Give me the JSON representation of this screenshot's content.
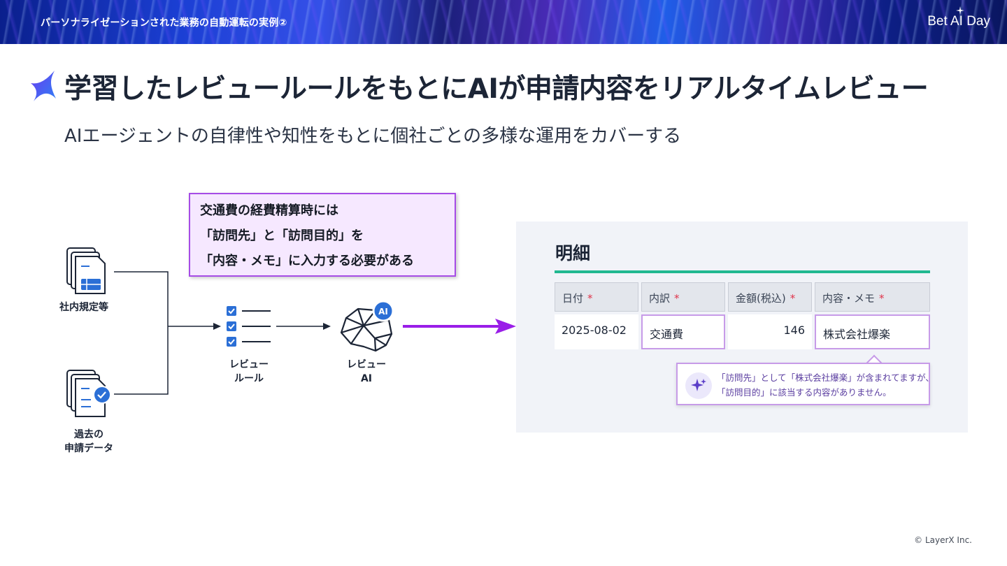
{
  "header": {
    "banner_title": "パーソナライゼーションされた業務の自動運転の実例②",
    "brand": "Bet AI Day"
  },
  "slide": {
    "title": "学習したレビュールールをもとにAIが申請内容をリアルタイムレビュー",
    "subtitle": "AIエージェントの自律性や知性をもとに個社ごとの多様な運用をカバーする"
  },
  "note": {
    "lines": [
      "交通費の経費精算時には",
      "「訪問先」と「訪問目的」を",
      "「内容・メモ」に入力する必要がある"
    ]
  },
  "diagram": {
    "inputs": [
      {
        "label": "社内規定等",
        "icon": "document-table-icon"
      },
      {
        "label_line1": "過去の",
        "label_line2": "申請データ",
        "icon": "document-check-icon"
      }
    ],
    "rules": {
      "label_line1": "レビュー",
      "label_line2": "ルール",
      "icon": "checklist-icon"
    },
    "ai": {
      "label_line1": "レビュー",
      "label_line2": "AI",
      "badge": "AI",
      "icon": "brain-network-icon"
    }
  },
  "form": {
    "title": "明細",
    "columns": [
      {
        "label": "日付",
        "required": "*"
      },
      {
        "label": "内訳",
        "required": "*"
      },
      {
        "label": "金額(税込)",
        "required": "*"
      },
      {
        "label": "内容・メモ",
        "required": "*"
      }
    ],
    "row": {
      "date": "2025-08-02",
      "category": "交通費",
      "amount": "146",
      "memo": "株式会社爆楽"
    },
    "tooltip": {
      "line1": "「訪問先」として「株式会社爆楽」が含まれてますが、",
      "line2": "「訪問目的」に該当する内容がありません。",
      "icon": "sparkle-icon"
    },
    "accent_color": "#20b890",
    "highlight_color": "#c79be8"
  },
  "colors": {
    "arrow": "#9a1ee8",
    "note_border": "#a64ce6",
    "note_bg": "#f6e8ff"
  },
  "footer": {
    "copyright": "© LayerX Inc."
  }
}
